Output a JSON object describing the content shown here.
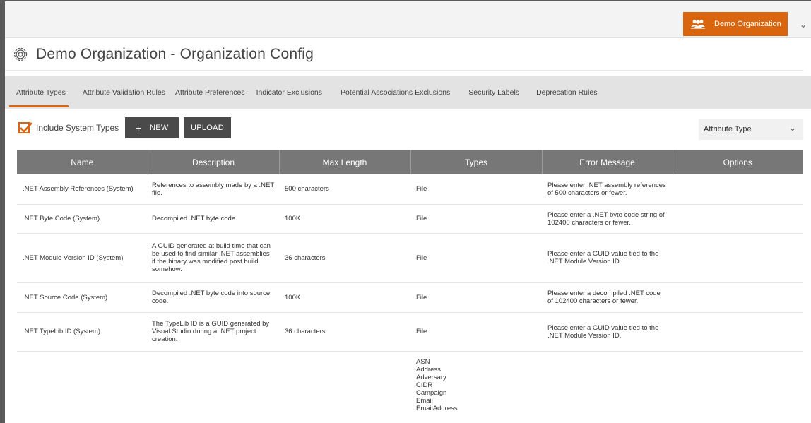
{
  "header": {
    "org_button_label": "Demo Organization"
  },
  "page": {
    "title": "Demo Organization - Organization Config"
  },
  "tabs": [
    {
      "label": "Attribute Types",
      "active": true
    },
    {
      "label": "Attribute Validation Rules",
      "active": false
    },
    {
      "label": "Attribute Preferences",
      "active": false
    },
    {
      "label": "Indicator Exclusions",
      "active": false
    },
    {
      "label": "Potential Associations Exclusions",
      "active": false
    },
    {
      "label": "Security Labels",
      "active": false
    },
    {
      "label": "Deprecation Rules",
      "active": false
    }
  ],
  "toolbar": {
    "include_system_types_label": "Include System Types",
    "include_system_types_checked": true,
    "new_label": "NEW",
    "upload_label": "UPLOAD",
    "filter_select_value": "Attribute Type"
  },
  "table": {
    "columns": [
      "Name",
      "Description",
      "Max Length",
      "Types",
      "Error Message",
      "Options"
    ],
    "rows": [
      {
        "name": ".NET Assembly References (System)",
        "description": "References to assembly made by a .NET file.",
        "max_length": "500 characters",
        "types": "File",
        "error_message": "Please enter .NET assembly references of 500 characters or fewer.",
        "options": ""
      },
      {
        "name": ".NET Byte Code (System)",
        "description": "Decompiled .NET byte code.",
        "max_length": "100K",
        "types": "File",
        "error_message": "Please enter a .NET byte code string of 102400 characters or fewer.",
        "options": ""
      },
      {
        "name": ".NET Module Version ID (System)",
        "description": "A GUID generated at build time that can be used to find similar .NET assemblies if the binary was modified post build somehow.",
        "max_length": "36 characters",
        "types": "File",
        "error_message": "Please enter a GUID value tied to the .NET Module Version ID.",
        "options": ""
      },
      {
        "name": ".NET Source Code (System)",
        "description": "Decompiled .NET byte code into source code.",
        "max_length": "100K",
        "types": "File",
        "error_message": "Please enter a decompiled .NET code of 102400 characters or fewer.",
        "options": ""
      },
      {
        "name": ".NET TypeLib ID (System)",
        "description": "The TypeLib ID is a GUID generated by Visual Studio during a .NET project creation.",
        "max_length": "36 characters",
        "types": "File",
        "error_message": "Please enter a GUID value tied to the .NET Module Version ID.",
        "options": ""
      }
    ],
    "partial_row_types": [
      "ASN",
      "Address",
      "Adversary",
      "CIDR",
      "Campaign",
      "Email",
      "EmailAddress"
    ]
  },
  "colors": {
    "accent": "#d9660f",
    "header_bg": "#777777",
    "tabs_bg": "#e3e3e3",
    "button_bg": "#4a4a4a"
  },
  "icons": {
    "org": "users-icon",
    "title": "gear-icon",
    "org_menu": "chevron-down-icon"
  }
}
